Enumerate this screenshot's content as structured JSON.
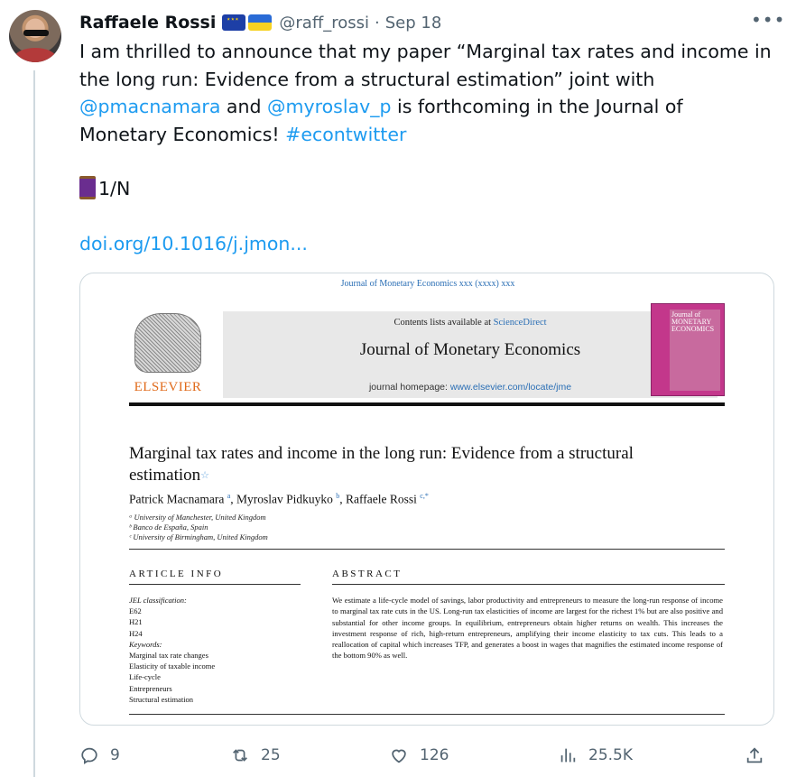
{
  "author": {
    "name": "Raffaele Rossi",
    "handle": "@raff_rossi",
    "separator": "·",
    "date": "Sep 18"
  },
  "tweet": {
    "line1_text": "I am thrilled to announce that my paper “Marginal tax rates and income in the long run: Evidence from a structural estimation” joint with ",
    "mention1": "@pmacnamara",
    "and": " and ",
    "mention2": "@myroslav_p",
    "line1_tail": " is forthcoming in the Journal of Monetary Economics!  ",
    "hashtag": "#econtwitter",
    "thread_marker": "1/N",
    "link": "doi.org/10.1016/j.jmon..."
  },
  "paper": {
    "journal_line": "Journal of Monetary Economics xxx (xxxx) xxx",
    "contents_prefix": "Contents lists available at ",
    "contents_link": "ScienceDirect",
    "journal_title": "Journal of Monetary Economics",
    "homepage_prefix": "journal homepage: ",
    "homepage_url": "www.elsevier.com/locate/jme",
    "publisher": "ELSEVIER",
    "cover_text": "Journal of MONETARY ECONOMICS",
    "title": "Marginal tax rates and income in the long run: Evidence from a structural estimation",
    "authors": [
      {
        "name": "Patrick Macnamara",
        "sup": "a"
      },
      {
        "name": "Myroslav Pidkuyko",
        "sup": "b"
      },
      {
        "name": "Raffaele Rossi",
        "sup": "c,*"
      }
    ],
    "affiliations": [
      "ᵃ University of Manchester, United Kingdom",
      "ᵇ Banco de España, Spain",
      "ᶜ University of Birmingham, United Kingdom"
    ],
    "article_info_heading": "ARTICLE INFO",
    "abstract_heading": "ABSTRACT",
    "jel_label": "JEL classification:",
    "jel_codes": [
      "E62",
      "H21",
      "H24"
    ],
    "keywords_label": "Keywords:",
    "keywords": [
      "Marginal tax rate changes",
      "Elasticity of taxable income",
      "Life-cycle",
      "Entrepreneurs",
      "Structural estimation"
    ],
    "abstract": "We estimate a life-cycle model of savings, labor productivity and entrepreneurs to measure the long-run response of income to marginal tax rate cuts in the US. Long-run tax elasticities of income are largest for the richest 1% but are also positive and substantial for other income groups. In equilibrium, entrepreneurs obtain higher returns on wealth. This increases the investment response of rich, high-return entrepreneurs, amplifying their income elasticity to tax cuts. This leads to a reallocation of capital which increases TFP, and generates a boost in wages that magnifies the estimated income response of the bottom 90% as well."
  },
  "actions": {
    "replies": "9",
    "reposts": "25",
    "likes": "126",
    "views": "25.5K"
  },
  "icons": {
    "more": "more-icon",
    "reply": "reply-icon",
    "repost": "repost-icon",
    "like": "heart-icon",
    "views": "views-icon",
    "share": "share-icon"
  }
}
